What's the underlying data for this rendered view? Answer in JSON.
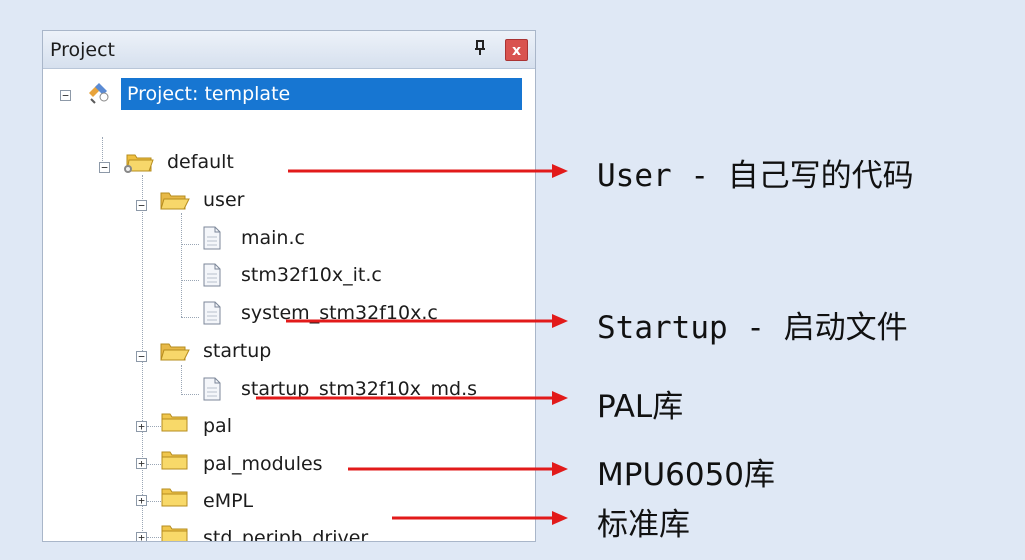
{
  "panel": {
    "title": "Project",
    "pin_glyph": "ㅁ",
    "close_glyph": "x"
  },
  "tree": {
    "root": "Project: template",
    "default": "default",
    "user": "user",
    "user_files": [
      "main.c",
      "stm32f10x_it.c",
      "system_stm32f10x.c"
    ],
    "startup": "startup",
    "startup_files": [
      "startup_stm32f10x_md.s"
    ],
    "pal": "pal",
    "pal_modules": "pal_modules",
    "empl": "eMPL",
    "std_periph_driver": "std_periph_driver",
    "collapse_glyph": "−",
    "expand_glyph": "+"
  },
  "annotations": {
    "user": "User - 自己写的代码",
    "startup": "Startup - 启动文件",
    "pal": "PAL库",
    "mpu": "MPU6050库",
    "std": "标准库"
  },
  "colors": {
    "background": "#dfe8f5",
    "selection": "#1776d2",
    "arrow": "#e21a1a",
    "close": "#d9534f"
  }
}
